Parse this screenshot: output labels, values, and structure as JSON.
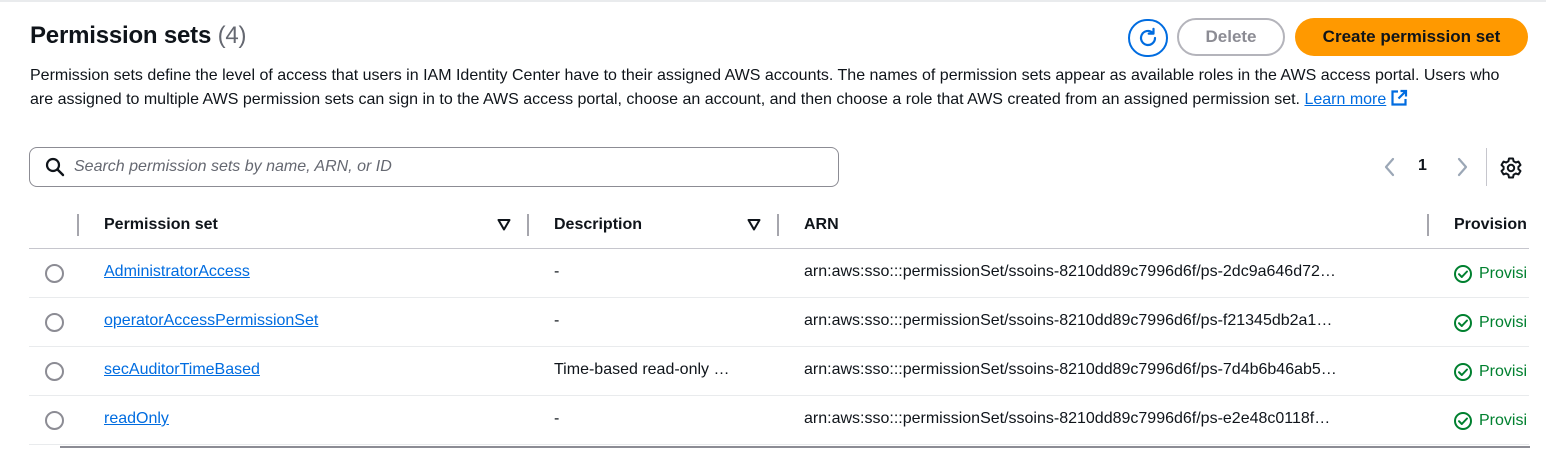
{
  "header": {
    "title": "Permission sets",
    "count": "(4)",
    "description": "Permission sets define the level of access that users in IAM Identity Center have to their assigned AWS accounts. The names of permission sets appear as available roles in the AWS access portal. Users who are assigned to multiple AWS permission sets can sign in to the AWS access portal, choose an account, and then choose a role that AWS created from an assigned permission set.",
    "learn_more": "Learn more"
  },
  "actions": {
    "refresh_icon": "refresh-icon",
    "delete_label": "Delete",
    "create_label": "Create permission set",
    "accent_color": "#ff9900",
    "link_color": "#006ce0"
  },
  "search": {
    "placeholder": "Search permission sets by name, ARN, or ID",
    "value": ""
  },
  "pagination": {
    "current_page": "1"
  },
  "table": {
    "columns": [
      "Permission set",
      "Description",
      "ARN",
      "Provision"
    ],
    "rows": [
      {
        "name": "AdministratorAccess",
        "description": "-",
        "arn": "arn:aws:sso:::permissionSet/ssoins-8210dd89c7996d6f/ps-2dc9a646d72…",
        "status": "Provisi"
      },
      {
        "name": "operatorAccessPermissionSet",
        "description": "-",
        "arn": "arn:aws:sso:::permissionSet/ssoins-8210dd89c7996d6f/ps-f21345db2a1…",
        "status": "Provisi"
      },
      {
        "name": "secAuditorTimeBased",
        "description": "Time-based read-only …",
        "arn": "arn:aws:sso:::permissionSet/ssoins-8210dd89c7996d6f/ps-7d4b6b46ab5…",
        "status": "Provisi"
      },
      {
        "name": "readOnly",
        "description": "-",
        "arn": "arn:aws:sso:::permissionSet/ssoins-8210dd89c7996d6f/ps-e2e48c0118f…",
        "status": "Provisi"
      }
    ],
    "status_color": "#00802f"
  }
}
